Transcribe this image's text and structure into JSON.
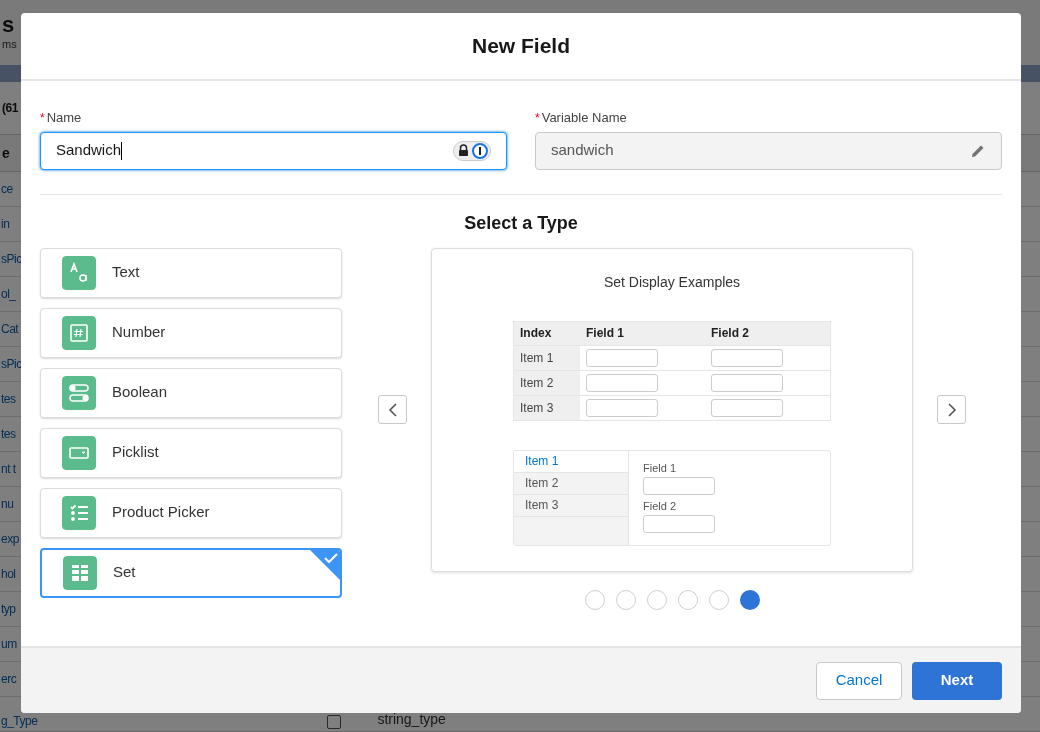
{
  "background": {
    "title": "s",
    "subtitle": "ms",
    "count": "(61",
    "column_header": "e",
    "rows": [
      {
        "column_1": "ce"
      },
      {
        "column_1": "in"
      },
      {
        "column_1": "sPic"
      },
      {
        "column_1": "ol_"
      },
      {
        "column_1": "Cat"
      },
      {
        "column_1": "sPic"
      },
      {
        "column_1": "tes"
      },
      {
        "column_1": "tes"
      },
      {
        "column_1": "nt t"
      },
      {
        "column_1": "nu"
      },
      {
        "column_1": "exp"
      },
      {
        "column_1": "hol"
      },
      {
        "column_1": "typ"
      },
      {
        "column_1": "um"
      },
      {
        "column_1": "erc"
      },
      {
        "column_1": "g_Type",
        "checked": false,
        "column_3": "string_type"
      }
    ]
  },
  "modal": {
    "title": "New Field",
    "name_field": {
      "required_mark": "*",
      "label": "Name",
      "value": "Sandwich"
    },
    "variable_name_field": {
      "required_mark": "*",
      "label": "Variable Name",
      "value": "sandwich",
      "disabled": true
    },
    "section_title": "Select a Type",
    "types": [
      {
        "kind": "text",
        "label": "Text",
        "selected": false
      },
      {
        "kind": "number",
        "label": "Number",
        "selected": false
      },
      {
        "kind": "boolean",
        "label": "Boolean",
        "selected": false
      },
      {
        "kind": "picklist",
        "label": "Picklist",
        "selected": false
      },
      {
        "kind": "product_picker",
        "label": "Product Picker",
        "selected": false
      },
      {
        "kind": "set",
        "label": "Set",
        "selected": true
      }
    ],
    "preview": {
      "title": "Set Display Examples",
      "table": {
        "columns": [
          "Index",
          "Field 1",
          "Field 2"
        ],
        "rows": [
          "Item 1",
          "Item 2",
          "Item 3"
        ]
      },
      "tabs": [
        {
          "label": "Item 1",
          "selected": true
        },
        {
          "label": "Item 2",
          "selected": false
        },
        {
          "label": "Item 3",
          "selected": false
        }
      ],
      "fields": [
        "Field 1",
        "Field 2"
      ]
    },
    "carousel_dots": [
      {
        "selected": false
      },
      {
        "selected": false
      },
      {
        "selected": false
      },
      {
        "selected": false
      },
      {
        "selected": false
      },
      {
        "selected": true
      }
    ],
    "buttons": {
      "cancel": "Cancel",
      "next": "Next"
    }
  }
}
